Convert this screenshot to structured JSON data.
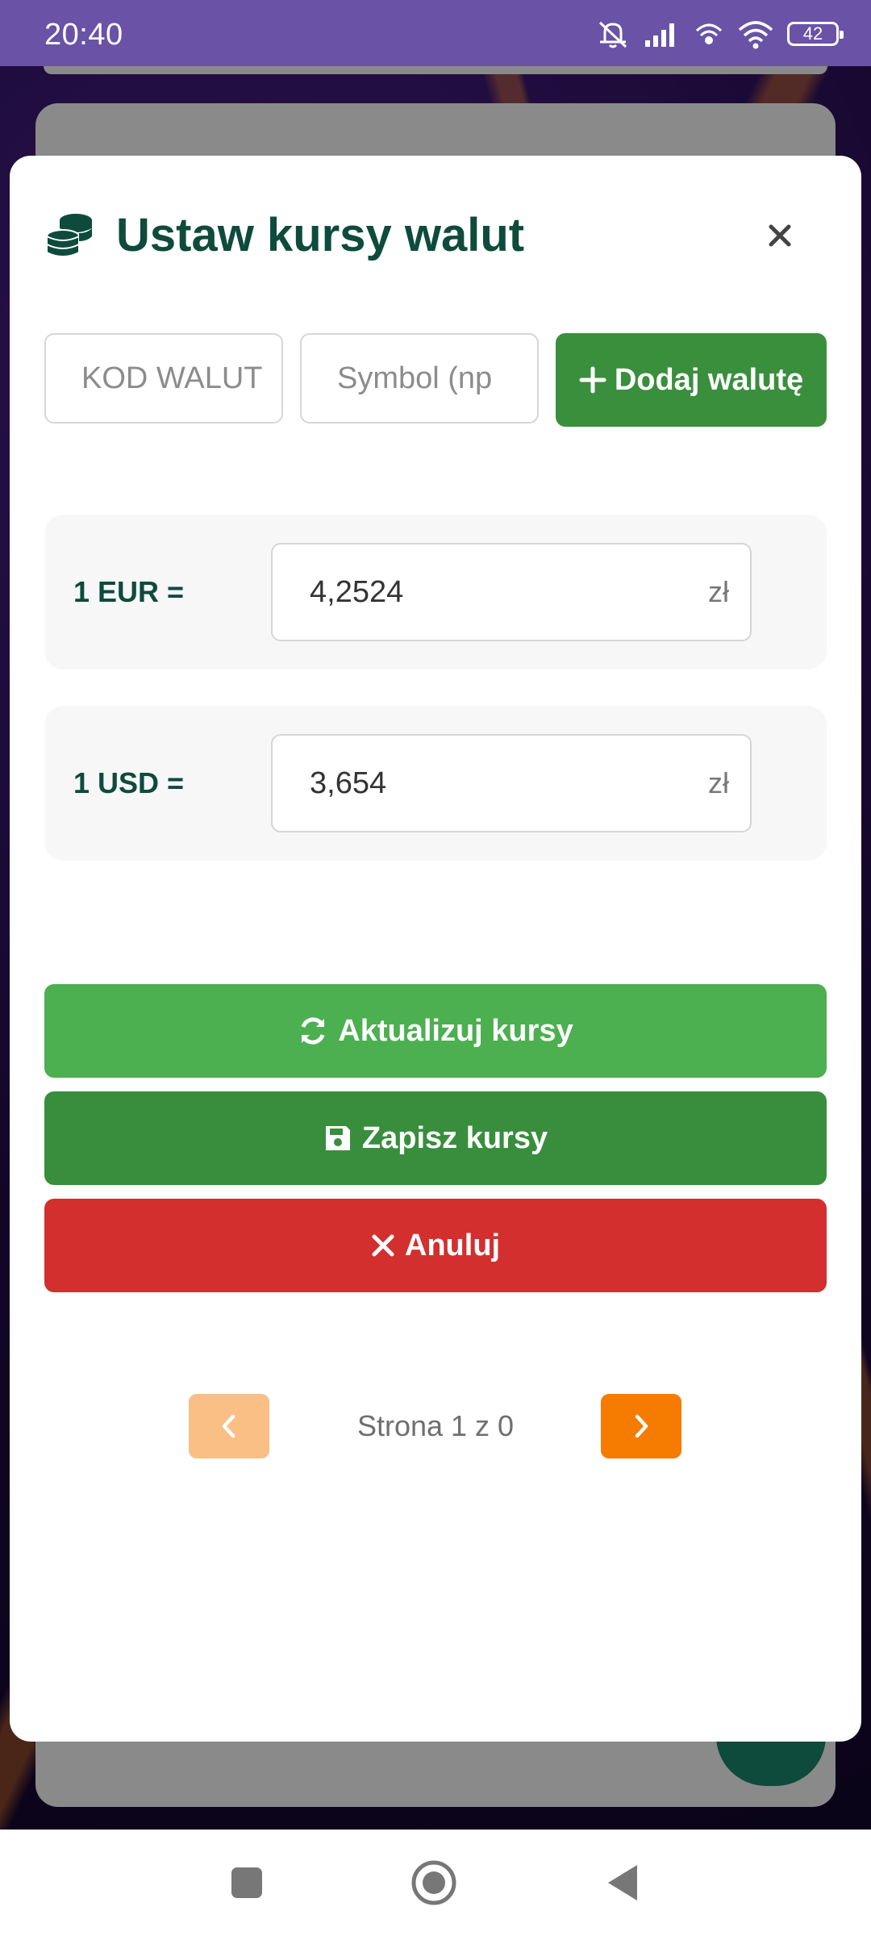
{
  "status_bar": {
    "time": "20:40",
    "battery": "42",
    "icons": [
      "mute-icon",
      "signal-icon",
      "hotspot-icon",
      "wifi-icon",
      "battery-icon"
    ]
  },
  "modal": {
    "title": "Ustaw kursy walut",
    "title_icon": "coins-icon",
    "close_icon": "close-icon",
    "add_currency": {
      "code_placeholder": "KOD WALUT",
      "symbol_placeholder": "Symbol (np",
      "add_button_label": "Dodaj walutę",
      "add_button_icon": "plus-icon"
    },
    "rates": [
      {
        "label": "1 EUR =",
        "value": "4,2524",
        "unit": "zł"
      },
      {
        "label": "1 USD =",
        "value": "3,654",
        "unit": "zł"
      }
    ],
    "actions": {
      "refresh_label": "Aktualizuj kursy",
      "save_label": "Zapisz kursy",
      "cancel_label": "Anuluj"
    },
    "pagination": {
      "text": "Strona 1 z 0"
    }
  },
  "colors": {
    "status_bar": "#6a52a6",
    "title": "#0e4b3c",
    "add_button": "#3a8f3d",
    "refresh_button": "#4caf50",
    "save_button": "#388e3c",
    "cancel_button": "#d32f2f",
    "pager_prev": "#f9bf85",
    "pager_next": "#f57c00"
  }
}
